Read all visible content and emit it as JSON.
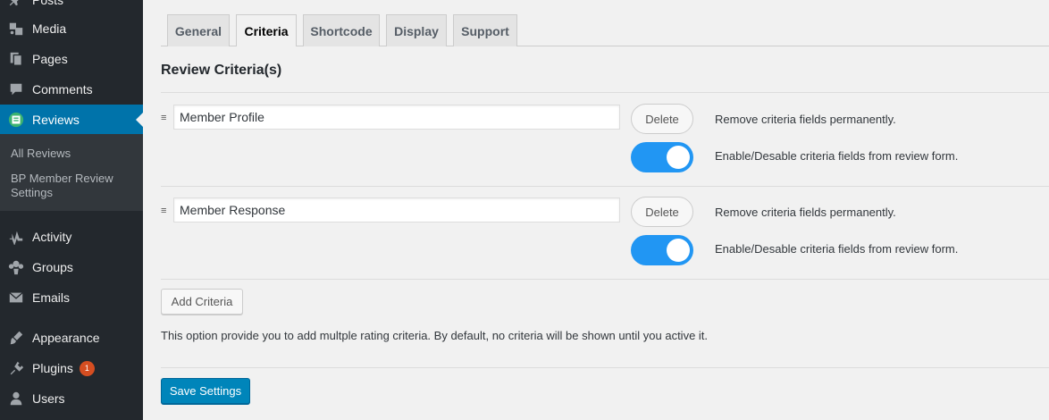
{
  "sidebar": {
    "items": [
      {
        "label": "Posts",
        "icon": "pin-icon"
      },
      {
        "label": "Media",
        "icon": "media-icon"
      },
      {
        "label": "Pages",
        "icon": "pages-icon"
      },
      {
        "label": "Comments",
        "icon": "comments-icon"
      },
      {
        "label": "Reviews",
        "icon": "reviews-icon",
        "active": true
      },
      {
        "label": "Activity",
        "icon": "activity-icon"
      },
      {
        "label": "Groups",
        "icon": "groups-icon"
      },
      {
        "label": "Emails",
        "icon": "emails-icon"
      },
      {
        "label": "Appearance",
        "icon": "appearance-icon"
      },
      {
        "label": "Plugins",
        "icon": "plugins-icon",
        "badge": "1"
      },
      {
        "label": "Users",
        "icon": "users-icon"
      }
    ],
    "submenu": [
      {
        "label": "All Reviews"
      },
      {
        "label": "BP Member Review Settings"
      }
    ]
  },
  "tabs": [
    {
      "label": "General"
    },
    {
      "label": "Criteria",
      "active": true
    },
    {
      "label": "Shortcode"
    },
    {
      "label": "Display"
    },
    {
      "label": "Support"
    }
  ],
  "main": {
    "title": "Review Criteria(s)",
    "drag_handle": "≡",
    "criteria": [
      {
        "value": "Member Profile",
        "delete_label": "Delete",
        "delete_help": "Remove criteria fields permanently.",
        "toggle_on": true,
        "toggle_help": "Enable/Desable criteria fields from review form."
      },
      {
        "value": "Member Response",
        "delete_label": "Delete",
        "delete_help": "Remove criteria fields permanently.",
        "toggle_on": true,
        "toggle_help": "Enable/Desable criteria fields from review form."
      }
    ],
    "add_label": "Add Criteria",
    "description": "This option provide you to add multple rating criteria. By default, no criteria will be shown until you active it.",
    "save_label": "Save Settings"
  },
  "colors": {
    "sidebar_bg": "#23282d",
    "submenu_bg": "#32373c",
    "active_menu": "#0073aa",
    "toggle_on": "#2196f3",
    "primary_button": "#0085ba",
    "badge": "#d54e21"
  }
}
